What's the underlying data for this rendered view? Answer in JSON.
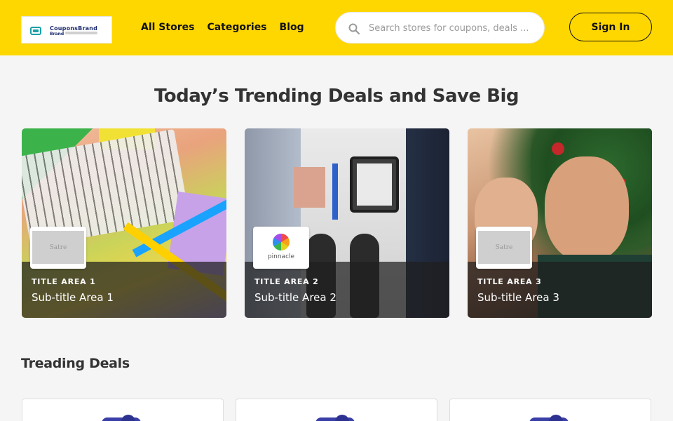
{
  "header": {
    "logo": {
      "line1": "CouponsBrand",
      "line2": "Brand"
    },
    "nav": [
      {
        "label": "All Stores"
      },
      {
        "label": "Categories"
      },
      {
        "label": "Blog"
      }
    ],
    "search": {
      "placeholder": "Search stores for coupons, deals ...",
      "value": ""
    },
    "signin_label": "Sign In",
    "background_color": "#ffd700"
  },
  "main": {
    "title": "Today’s Trending Deals and Save Big",
    "promo_cards": [
      {
        "title": "TITLE AREA 1",
        "subtitle": "Sub-title Area 1",
        "brand_label": "Satre"
      },
      {
        "title": "TITLE AREA 2",
        "subtitle": "Sub-title Area 2",
        "brand_label": "pinnacle"
      },
      {
        "title": "TITLE AREA 3",
        "subtitle": "Sub-title Area 3",
        "brand_label": "Satre"
      }
    ],
    "section_title": "Treading Deals"
  }
}
